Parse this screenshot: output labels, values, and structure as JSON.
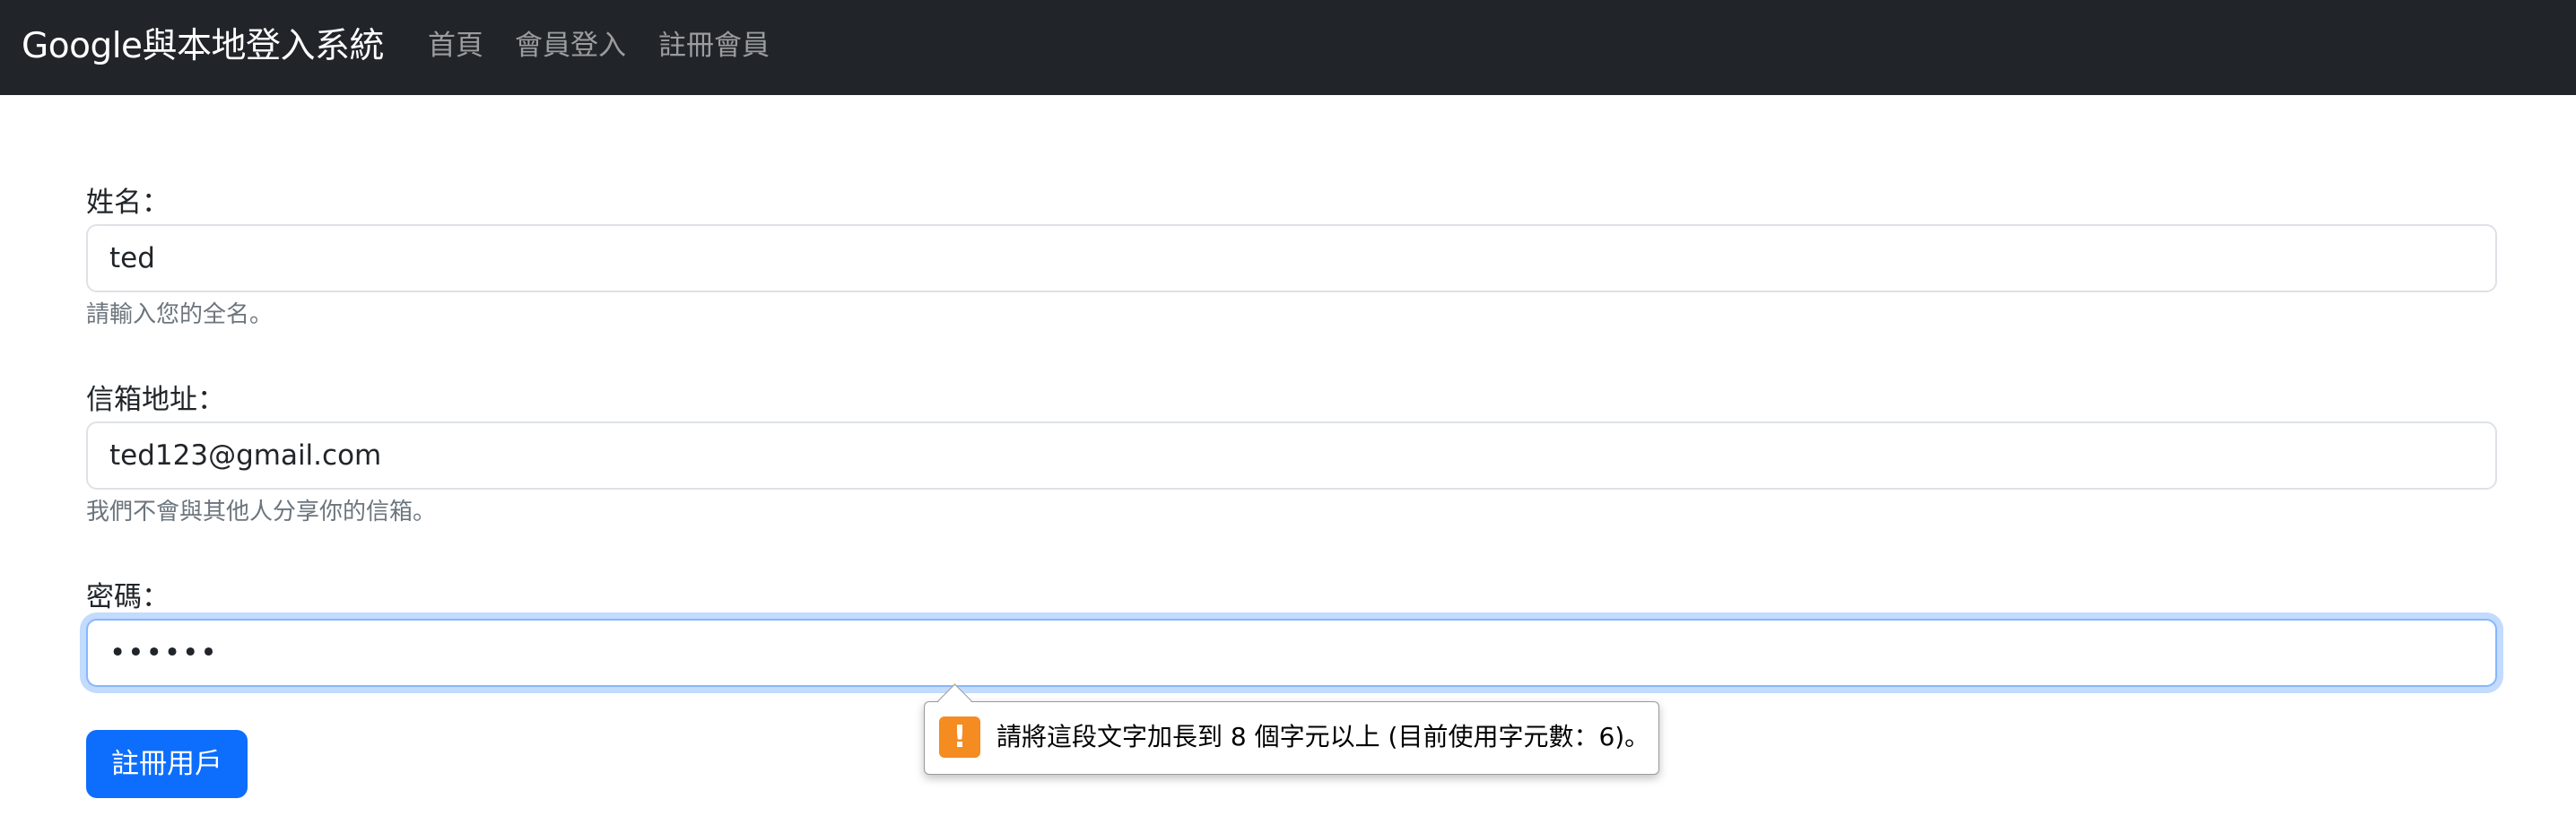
{
  "navbar": {
    "brand": "Google與本地登入系統",
    "links": [
      "首頁",
      "會員登入",
      "註冊會員"
    ]
  },
  "form": {
    "name": {
      "label": "姓名：",
      "value": "ted",
      "help": "請輸入您的全名。"
    },
    "email": {
      "label": "信箱地址：",
      "value": "ted123@gmail.com",
      "help": "我們不會與其他人分享你的信箱。"
    },
    "password": {
      "label": "密碼：",
      "value": "••••••"
    },
    "submit_label": "註冊用戶"
  },
  "validation": {
    "icon": "exclamation-icon",
    "icon_glyph": "!",
    "message": "請將這段文字加長到 8 個字元以上 (目前使用字元數：6)。"
  },
  "colors": {
    "navbar_bg": "#212529",
    "primary": "#0d6efd",
    "warning_icon": "#f48c21"
  }
}
